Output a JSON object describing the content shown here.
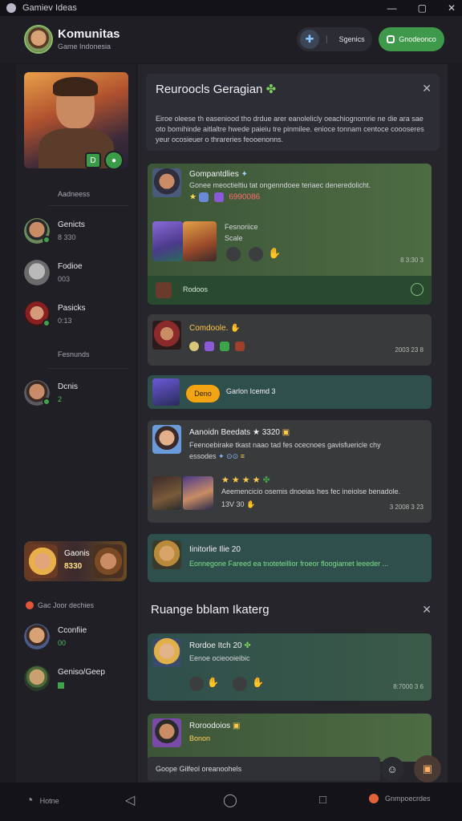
{
  "window": {
    "title": "Gamiev Ideas"
  },
  "header": {
    "title": "Komunitas",
    "subtitle": "Game Indonesia",
    "pill_label": "Sgenics",
    "primary_button": "Gnodeonco"
  },
  "sidebar": {
    "hero_badge_left": "D",
    "section_1": "Aadneess",
    "items": [
      {
        "name": "Genicts",
        "meta": "8 330"
      },
      {
        "name": "Fodioe",
        "meta": "003"
      },
      {
        "name": "Pasicks",
        "meta": "0:13"
      }
    ],
    "section_2": "Fesnunds",
    "items_2": [
      {
        "name": "Dcnis",
        "meta": "2"
      }
    ],
    "promo": {
      "name": "Gaonis",
      "meta": "8330"
    },
    "section_3": "Gac Joor dechies",
    "items_3": [
      {
        "name": "Cconfiie",
        "meta": "00"
      },
      {
        "name": "Geniso/Geep",
        "meta": ""
      }
    ]
  },
  "intro": {
    "title": "Reuroocls Geragian",
    "body": "Eiroe oleese th easeniood tho drdue arer eanolelicly oeachiognomrie ne die ara sae oto bomihinde aitlaltre hwede paieiu tre pinmilee. enioce tonnam centoce coooseres yeur ocosieuer o thrareries feooenonns."
  },
  "feed": [
    {
      "title": "Gompantdlies",
      "text": "Gonee meoctieltiu tat ongenndoee teriaec deneredolicht.",
      "reaction": "6990086",
      "sub_title": "Fesnoriice",
      "sub_text": "Scale",
      "time": "8 3:30 3",
      "footer_label": "Rodoos"
    },
    {
      "title": "Comdoole.",
      "time": "2003 23 8"
    },
    {
      "button": "Deno",
      "text": "Garlon Icemd 3"
    },
    {
      "title": "Aanoidn Beedats",
      "title_extra": "3320",
      "text": "Feenoebirake tkast naao tad fes ocecnoes gavisfuericle chy",
      "text2": "essodes",
      "text3": "Aeemencicio osemis dnoeias hes fec ineiolse benadole.",
      "meta": "13V 30",
      "time": "3 2008 3 23"
    },
    {
      "title": "Iinitorlie Ilie 20",
      "text": "Eonnegone Fareed ea tnoteteillior froeor floogiamet leeeder ..."
    }
  ],
  "section2": {
    "title": "Ruange bblam Ikaterg",
    "cards": [
      {
        "title": "Rordoe Itch 20",
        "text": "Eenoe ocieooieibic",
        "time": "8:7000 3 6"
      },
      {
        "title": "Roroodoios",
        "text": "Bonon"
      }
    ]
  },
  "input": {
    "placeholder": "Goope Gilfeol oreanoohels"
  },
  "nav": {
    "home": "Hotne",
    "right": "Gnmpoecrdes"
  }
}
